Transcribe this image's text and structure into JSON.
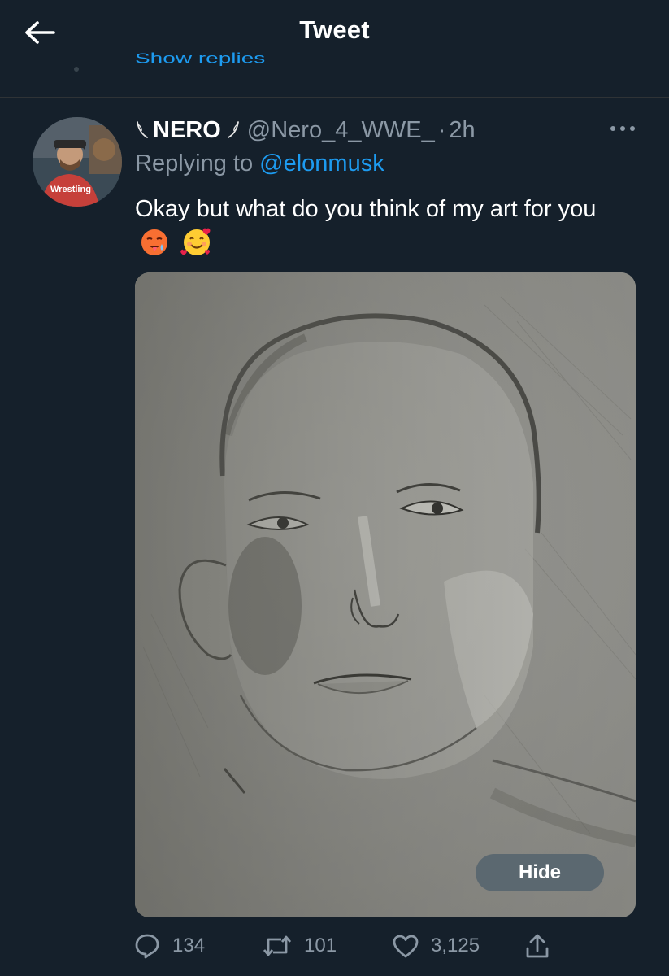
{
  "header": {
    "title": "Tweet"
  },
  "thread": {
    "show_replies": "Show replies"
  },
  "tweet": {
    "display_name": "NERO",
    "handle": "@Nero_4_WWE_",
    "separator": "·",
    "time": "2h",
    "replying_prefix": "Replying to",
    "replying_to": "@elonmusk",
    "text": "Okay but what do you think of my art for you",
    "emojis": [
      "hot-face-emoji",
      "smiling-face-with-hearts-emoji"
    ],
    "media": {
      "hide_label": "Hide"
    },
    "stats": {
      "replies": "134",
      "retweets": "101",
      "likes": "3,125"
    }
  },
  "colors": {
    "background": "#15202b",
    "accent": "#1d9bf0",
    "secondary_text": "#8b98a5",
    "divider": "#2f3336"
  },
  "icons": [
    "back-arrow-icon",
    "leaf-icon",
    "more-icon",
    "reply-icon",
    "retweet-icon",
    "like-icon",
    "share-icon"
  ]
}
